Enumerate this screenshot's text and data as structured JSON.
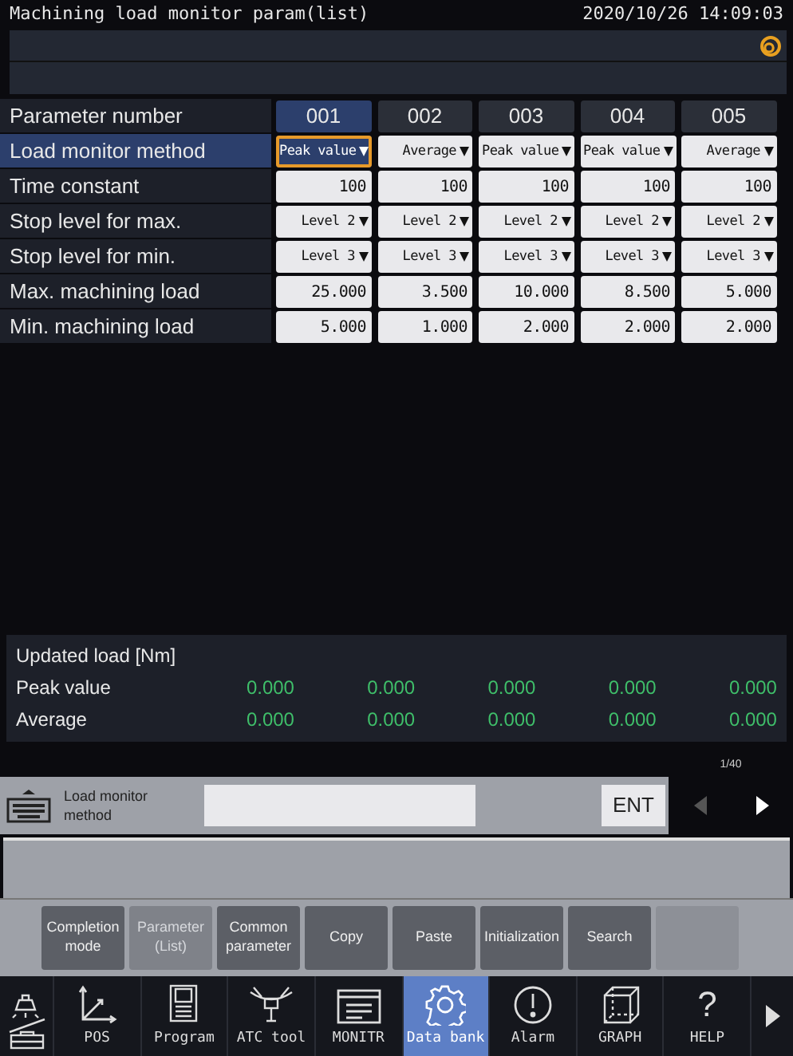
{
  "window": {
    "title": "Machining load monitor param(list)",
    "datetime": "2020/10/26 14:09:03"
  },
  "table": {
    "header_label": "Parameter number",
    "columns": [
      {
        "label": "001",
        "selected": true
      },
      {
        "label": "002",
        "selected": false
      },
      {
        "label": "003",
        "selected": false
      },
      {
        "label": "004",
        "selected": false
      },
      {
        "label": "005",
        "selected": false
      }
    ],
    "rows": [
      {
        "label": "Load monitor method",
        "selected": true,
        "kind": "dropdown",
        "cells": [
          {
            "value": "Peak value",
            "focused": true
          },
          {
            "value": "Average",
            "focused": false
          },
          {
            "value": "Peak value",
            "focused": false
          },
          {
            "value": "Peak value",
            "focused": false
          },
          {
            "value": "Average",
            "focused": false
          }
        ]
      },
      {
        "label": "Time constant",
        "selected": false,
        "kind": "number",
        "cells": [
          {
            "value": "100",
            "focused": false
          },
          {
            "value": "100",
            "focused": false
          },
          {
            "value": "100",
            "focused": false
          },
          {
            "value": "100",
            "focused": false
          },
          {
            "value": "100",
            "focused": false
          }
        ]
      },
      {
        "label": "Stop level for max.",
        "selected": false,
        "kind": "dropdown",
        "cells": [
          {
            "value": "Level 2",
            "focused": false
          },
          {
            "value": "Level 2",
            "focused": false
          },
          {
            "value": "Level 2",
            "focused": false
          },
          {
            "value": "Level 2",
            "focused": false
          },
          {
            "value": "Level 2",
            "focused": false
          }
        ]
      },
      {
        "label": "Stop level for min.",
        "selected": false,
        "kind": "dropdown",
        "cells": [
          {
            "value": "Level 3",
            "focused": false
          },
          {
            "value": "Level 3",
            "focused": false
          },
          {
            "value": "Level 3",
            "focused": false
          },
          {
            "value": "Level 3",
            "focused": false
          },
          {
            "value": "Level 3",
            "focused": false
          }
        ]
      },
      {
        "label": "Max. machining load",
        "selected": false,
        "kind": "number",
        "cells": [
          {
            "value": "25.000",
            "focused": false
          },
          {
            "value": "3.500",
            "focused": false
          },
          {
            "value": "10.000",
            "focused": false
          },
          {
            "value": "8.500",
            "focused": false
          },
          {
            "value": "5.000",
            "focused": false
          }
        ]
      },
      {
        "label": "Min. machining load",
        "selected": false,
        "kind": "number",
        "cells": [
          {
            "value": "5.000",
            "focused": false
          },
          {
            "value": "1.000",
            "focused": false
          },
          {
            "value": "2.000",
            "focused": false
          },
          {
            "value": "2.000",
            "focused": false
          },
          {
            "value": "2.000",
            "focused": false
          }
        ]
      }
    ]
  },
  "updated_load": {
    "title": "Updated load [Nm]",
    "rows": [
      {
        "label": "Peak value",
        "values": [
          "0.000",
          "0.000",
          "0.000",
          "0.000",
          "0.000"
        ]
      },
      {
        "label": "Average",
        "values": [
          "0.000",
          "0.000",
          "0.000",
          "0.000",
          "0.000"
        ]
      }
    ]
  },
  "input_bar": {
    "label": "Load monitor method",
    "enter_key": "ENT",
    "page": "1/40"
  },
  "function_keys": [
    {
      "kind": "key",
      "label": "Completion mode",
      "disabled": false
    },
    {
      "kind": "key",
      "label": "Parameter (List)",
      "disabled": true
    },
    {
      "kind": "key",
      "label": "Common parameter",
      "disabled": false
    },
    {
      "kind": "key",
      "label": "Copy",
      "disabled": false
    },
    {
      "kind": "key",
      "label": "Paste",
      "disabled": false
    },
    {
      "kind": "key",
      "label": "Initialization",
      "disabled": false
    },
    {
      "kind": "key",
      "label": "Search",
      "disabled": false
    },
    {
      "kind": "blank"
    }
  ],
  "nav_tabs": [
    {
      "selected": false
    },
    {
      "label": "POS",
      "selected": false
    },
    {
      "label": "Program",
      "selected": false
    },
    {
      "label": "ATC tool",
      "selected": false
    },
    {
      "label": "MONITR",
      "selected": false
    },
    {
      "label": "Data bank",
      "selected": true
    },
    {
      "label": "Alarm",
      "selected": false
    },
    {
      "label": "GRAPH",
      "selected": false
    },
    {
      "glyph": "?",
      "label": "HELP",
      "selected": false
    }
  ]
}
